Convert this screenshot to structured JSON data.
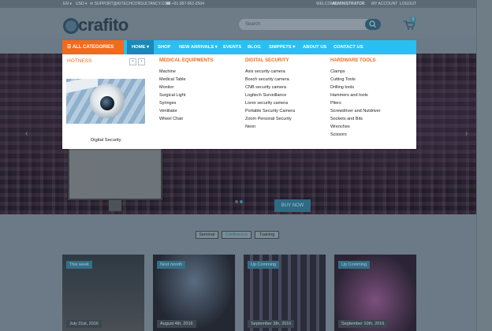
{
  "topbar": {
    "lang": "EN ▾",
    "currency": "USD ▾",
    "email": "✉ SUPPORT@KITECHCONSULTANCY.COM",
    "phone": "☎ +91-987-962-2504",
    "welcome": "WELCOME,",
    "user": "ADMINISTRATOR",
    "account": "MY ACCOUNT",
    "logout": "LOGOUT"
  },
  "header": {
    "logo_text": "crafito",
    "search_placeholder": "Search",
    "cart_count": "0"
  },
  "navbar": {
    "all_categories": "☰ ALL CATEGORIES",
    "items": [
      {
        "label": "HOME ▾"
      },
      {
        "label": "SHOP"
      },
      {
        "label": "NEW ARRIVALS ▾"
      },
      {
        "label": "EVENTS"
      },
      {
        "label": "BLOG"
      },
      {
        "label": "SNIPPETS ▾"
      },
      {
        "label": "ABOUT US"
      },
      {
        "label": "CONTACT US"
      }
    ]
  },
  "mega_menu": {
    "hotness_title": "HOTNESS",
    "prev": "‹",
    "next": "›",
    "featured_caption": "Digital Security",
    "columns": [
      {
        "title": "Medical Equipments",
        "items": [
          "Machine",
          "Medical Table",
          "Monitor",
          "Surgical Light",
          "Syringes",
          "Ventilator",
          "Wheel Chair"
        ]
      },
      {
        "title": "Digital Security",
        "items": [
          "Axis security camera",
          "Bosch security camera",
          "CNB security camera",
          "Logitech Surveillance",
          "Lorex security camera",
          "Portable Security Camera",
          "Zoom Personal Security",
          "Neon"
        ]
      },
      {
        "title": "Hardware Tools",
        "items": [
          "Clamps",
          "Cutting Tools",
          "Drilling tools",
          "Hammers and tools",
          "Pliers",
          "Screwdriver and Nutdriver",
          "Sockets and Bits",
          "Wrenches",
          "Scissors"
        ]
      }
    ]
  },
  "hero": {
    "button": "BUY NOW",
    "prev_arrow": "‹",
    "next_arrow": "›"
  },
  "filters": [
    "Seminar",
    "Conference",
    "Training"
  ],
  "events": [
    {
      "tag": "This week",
      "date": "July 31st, 2016"
    },
    {
      "tag": "Next month",
      "date": "August 4th, 2016"
    },
    {
      "tag": "Up Comming",
      "date": "September 3th, 2016"
    },
    {
      "tag": "Up Comming",
      "date": "September 10th, 2016"
    }
  ],
  "colors": {
    "accent_blue": "#2bbef0",
    "accent_orange": "#f26a1b",
    "nav_active": "#1b88b9"
  }
}
